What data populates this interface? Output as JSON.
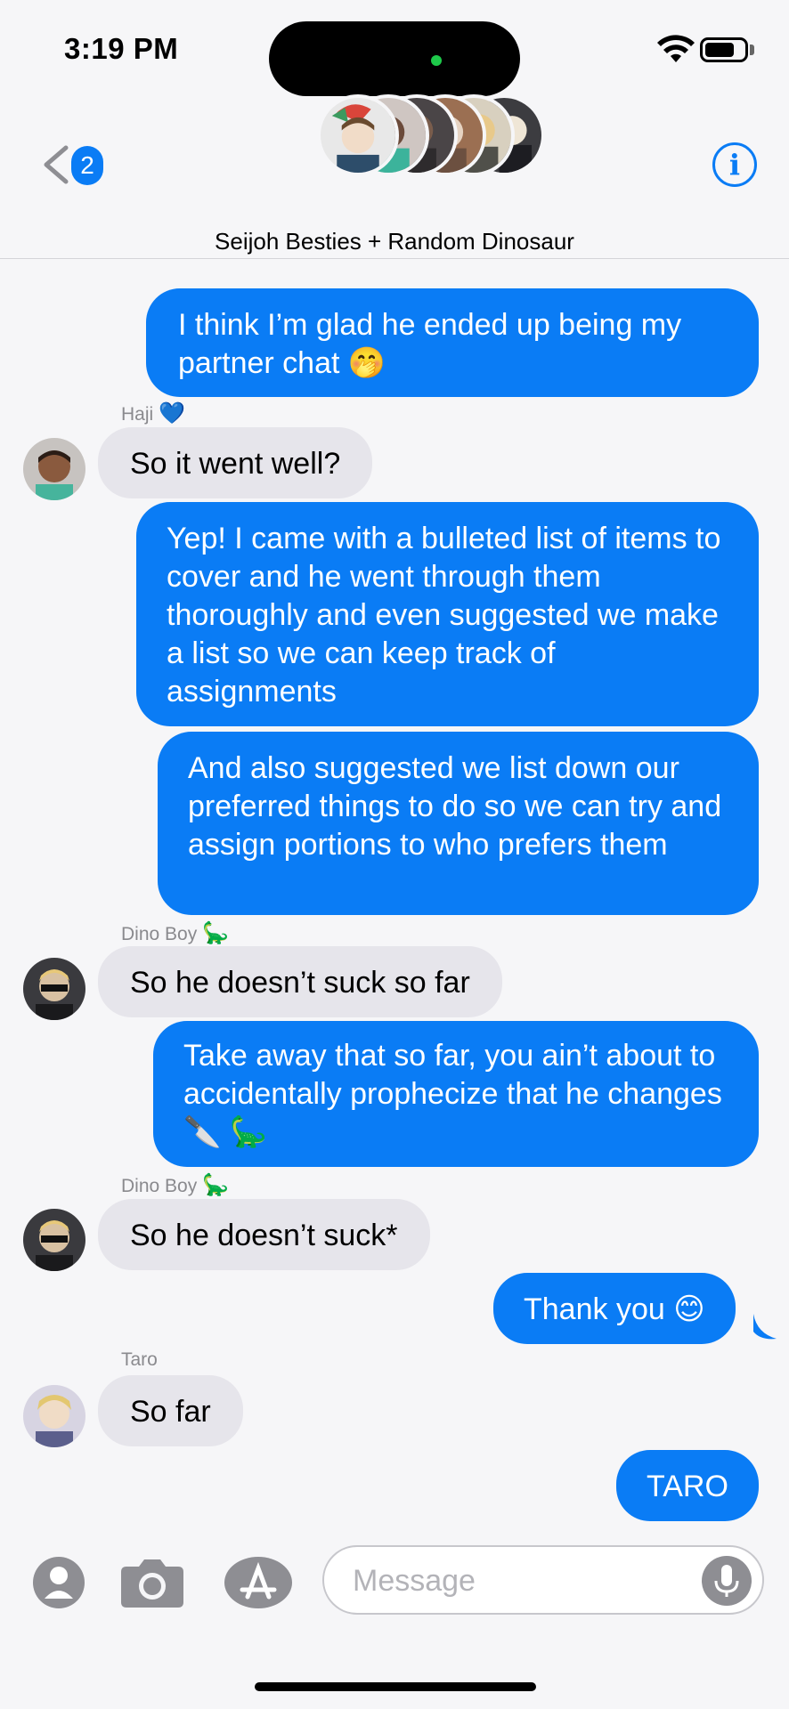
{
  "status_bar": {
    "time": "3:19 PM"
  },
  "header": {
    "back_badge": "2",
    "group_name": "Seijoh Besties + Random Dinosaur",
    "info_symbol": "i"
  },
  "messages": [
    {
      "direction": "outgoing",
      "text": "I think I’m glad he ended up being my partner chat 🤭"
    },
    {
      "direction": "incoming",
      "sender": "Haji",
      "sender_emoji": "💙",
      "text": "So it went well?"
    },
    {
      "direction": "outgoing",
      "text": "Yep! I came with a bulleted list of items to cover and he went through them thoroughly and even suggested we make a list so we can keep track of assignments"
    },
    {
      "direction": "outgoing",
      "text": "And also suggested we list down our preferred things to do so we can try and assign portions to who prefers them"
    },
    {
      "direction": "incoming",
      "sender": "Dino Boy",
      "sender_emoji": "🦕",
      "text": "So he doesn’t suck so far"
    },
    {
      "direction": "outgoing",
      "text": "Take away that so far, you ain’t about to accidentally prophecize that he changes 🔪 🦕"
    },
    {
      "direction": "incoming",
      "sender": "Dino Boy",
      "sender_emoji": "🦕",
      "text": "So he doesn’t suck*"
    },
    {
      "direction": "outgoing",
      "text": "Thank you 😊"
    },
    {
      "direction": "incoming",
      "sender": "Taro",
      "sender_emoji": "",
      "text": "So far"
    },
    {
      "direction": "outgoing",
      "text": "TARO"
    }
  ],
  "composer": {
    "placeholder": "Message"
  },
  "colors": {
    "accent": "#0a7cf5",
    "incoming_bubble": "#e6e5eb",
    "background": "#f6f6f8"
  }
}
